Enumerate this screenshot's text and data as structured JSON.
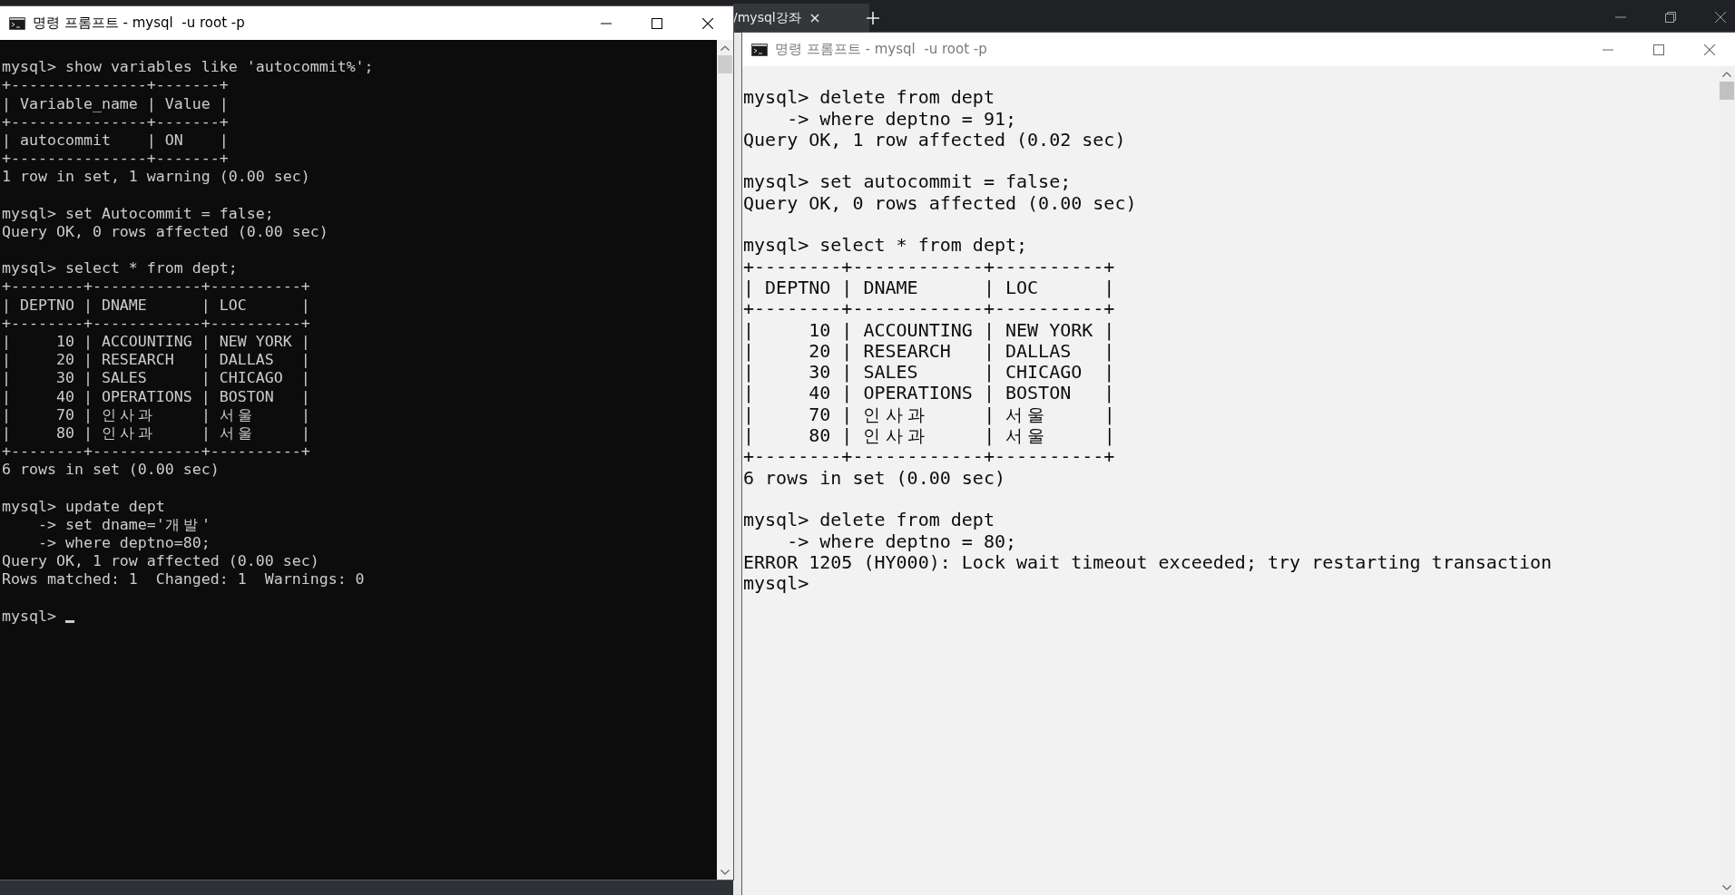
{
  "browser": {
    "tab_title": "/mysql강좌"
  },
  "windows": [
    {
      "title": "명령 프롬프트 - mysql  -u root -p",
      "kind": "dark",
      "active": true,
      "cursor": true,
      "blocks": [
        [
          "mysql> show variables like 'autocommit%';",
          "+---------------+-------+",
          "| Variable_name | Value |",
          "+---------------+-------+",
          "| autocommit    | ON    |",
          "+---------------+-------+",
          "1 row in set, 1 warning (0.00 sec)"
        ],
        [
          "mysql> set Autocommit = false;",
          "Query OK, 0 rows affected (0.00 sec)"
        ],
        [
          "mysql> select * from dept;",
          "+--------+------------+----------+",
          "| DEPTNO | DNAME      | LOC      |",
          "+--------+------------+----------+",
          "|     10 | ACCOUNTING | NEW YORK |",
          "|     20 | RESEARCH   | DALLAS   |",
          "|     30 | SALES      | CHICAGO  |",
          "|     40 | OPERATIONS | BOSTON   |",
          "|     70 | 인사과     | 서울     |",
          "|     80 | 인사과     | 서울     |",
          "+--------+------------+----------+",
          "6 rows in set (0.00 sec)"
        ],
        [
          "mysql> update dept",
          "    -> set dname='개발'",
          "    -> where deptno=80;",
          "Query OK, 1 row affected (0.00 sec)",
          "Rows matched: 1  Changed: 1  Warnings: 0"
        ],
        [
          "mysql>"
        ]
      ]
    },
    {
      "title": "명령 프롬프트 - mysql  -u root -p",
      "kind": "light",
      "active": false,
      "cursor": false,
      "blocks": [
        [
          "mysql> delete from dept",
          "    -> where deptno = 91;",
          "Query OK, 1 row affected (0.02 sec)"
        ],
        [
          "mysql> set autocommit = false;",
          "Query OK, 0 rows affected (0.00 sec)"
        ],
        [
          "mysql> select * from dept;",
          "+--------+------------+----------+",
          "| DEPTNO | DNAME      | LOC      |",
          "+--------+------------+----------+",
          "|     10 | ACCOUNTING | NEW YORK |",
          "|     20 | RESEARCH   | DALLAS   |",
          "|     30 | SALES      | CHICAGO  |",
          "|     40 | OPERATIONS | BOSTON   |",
          "|     70 | 인사과     | 서울     |",
          "|     80 | 인사과     | 서울     |",
          "+--------+------------+----------+",
          "6 rows in set (0.00 sec)"
        ],
        [
          "mysql> delete from dept",
          "    -> where deptno = 80;",
          "ERROR 1205 (HY000): Lock wait timeout exceeded; try restarting transaction",
          "mysql>"
        ]
      ]
    }
  ]
}
